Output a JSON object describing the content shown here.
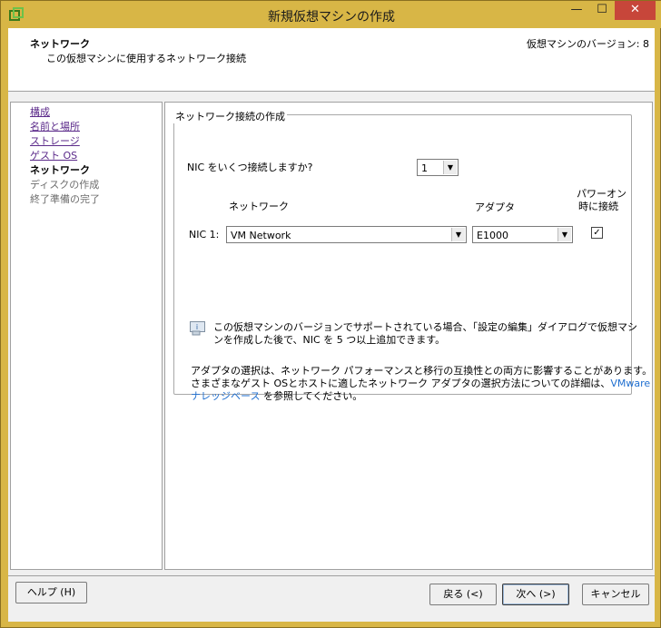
{
  "window": {
    "title": "新規仮想マシンの作成",
    "min_glyph": "—",
    "max_glyph": "☐",
    "close_glyph": "✕"
  },
  "header": {
    "title": "ネットワーク",
    "subtitle": "この仮想マシンに使用するネットワーク接続",
    "version": "仮想マシンのバージョン: 8"
  },
  "steps": [
    {
      "label": "構成",
      "state": "link"
    },
    {
      "label": "名前と場所",
      "state": "link"
    },
    {
      "label": "ストレージ",
      "state": "link"
    },
    {
      "label": "ゲスト OS",
      "state": "link"
    },
    {
      "label": "ネットワーク",
      "state": "current"
    },
    {
      "label": "ディスクの作成",
      "state": "disabled"
    },
    {
      "label": "終了準備の完了",
      "state": "disabled"
    }
  ],
  "main": {
    "group_title": "ネットワーク接続の作成",
    "nic_count_question": "NIC をいくつ接続しますか?",
    "nic_count_value": "1",
    "col_network": "ネットワーク",
    "col_adapter": "アダプタ",
    "col_power_on_1": "パワーオン",
    "col_power_on_2": "時に接続",
    "nic_rows": [
      {
        "label": "NIC 1:",
        "network": "VM Network",
        "adapter": "E1000",
        "connect_at_power_on": true
      }
    ],
    "info_line1": "この仮想マシンのバージョンでサポートされている場合、「設定の編集」ダイアログで仮想マシ",
    "info_line2": "ンを作成した後で、NIC を 5 つ以上追加できます。",
    "adapter_note_line1": "アダプタの選択は、ネットワーク パフォーマンスと移行の互換性との両方に影響することがあります。",
    "adapter_note_line2a": "さまざまなゲスト OSとホストに適したネットワーク アダプタの選択方法についての詳細は、",
    "adapter_note_link1": "VMware",
    "adapter_note_link2": "ナレッジベース",
    "adapter_note_line3b": " を参照してください。"
  },
  "footer": {
    "help": "ヘルプ (H)",
    "back": "戻る (<)",
    "next": "次へ (>)",
    "cancel": "キャンセル"
  },
  "colors": {
    "frame": "#d8b646",
    "close_button": "#c7463a",
    "visited_link": "#5b2a8a",
    "link": "#1f6fd0"
  }
}
